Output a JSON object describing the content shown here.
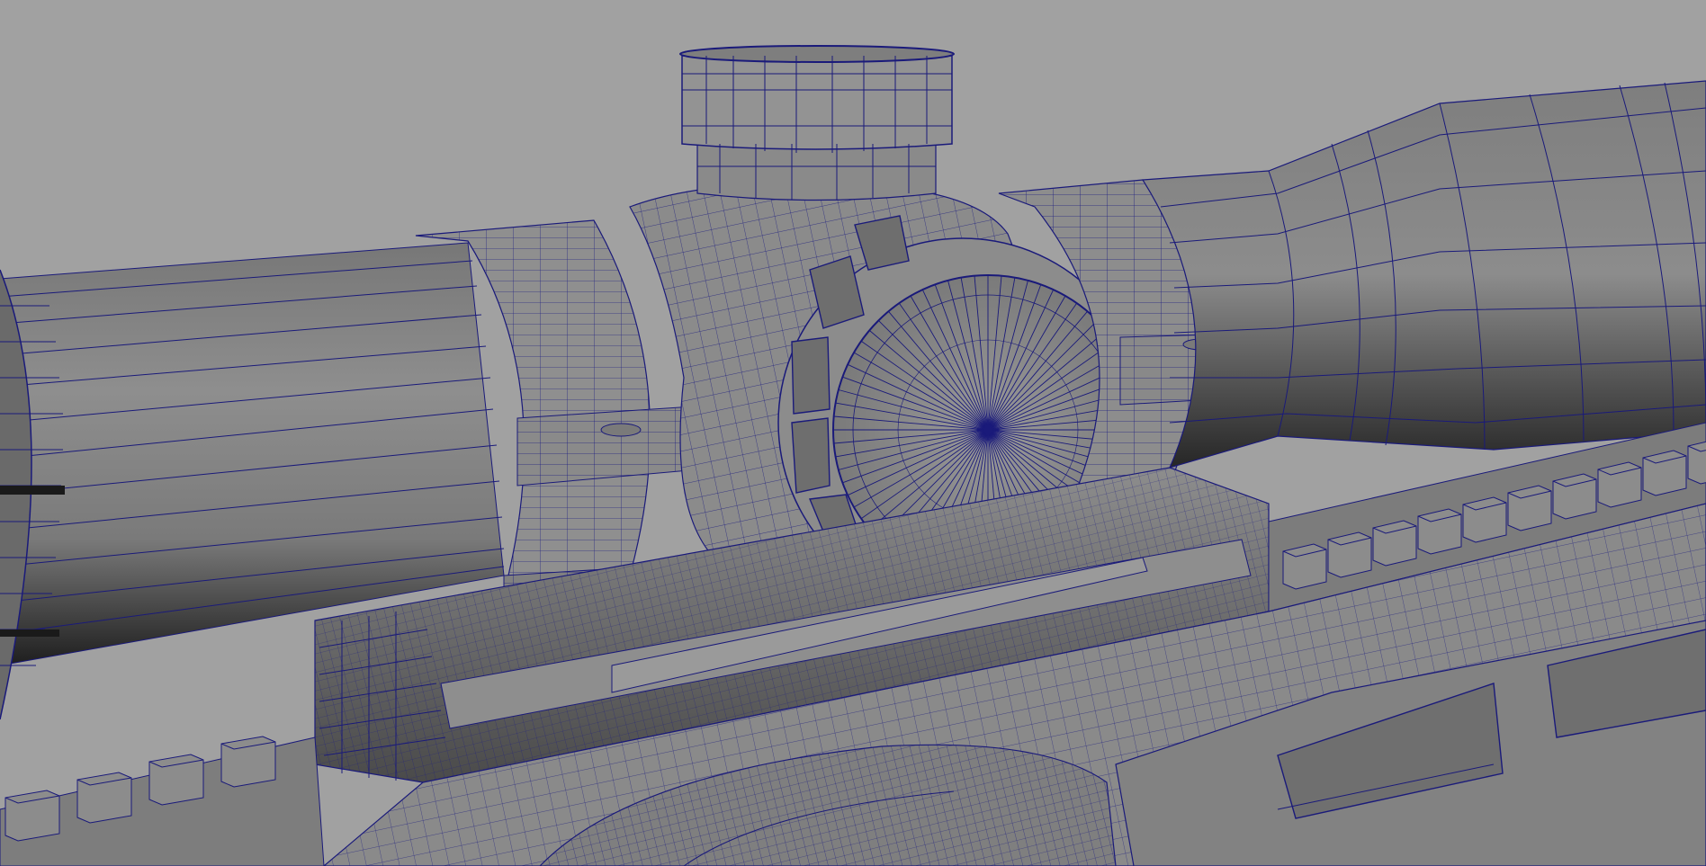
{
  "viewport": {
    "panel": "perspective-viewport",
    "display_mode": "wireframe-on-shaded",
    "background_color": "#a1a1a1",
    "surface_color": "#8c8c8c",
    "wire_color": "#1a1a7a",
    "subject": "rifle-scope-model"
  }
}
